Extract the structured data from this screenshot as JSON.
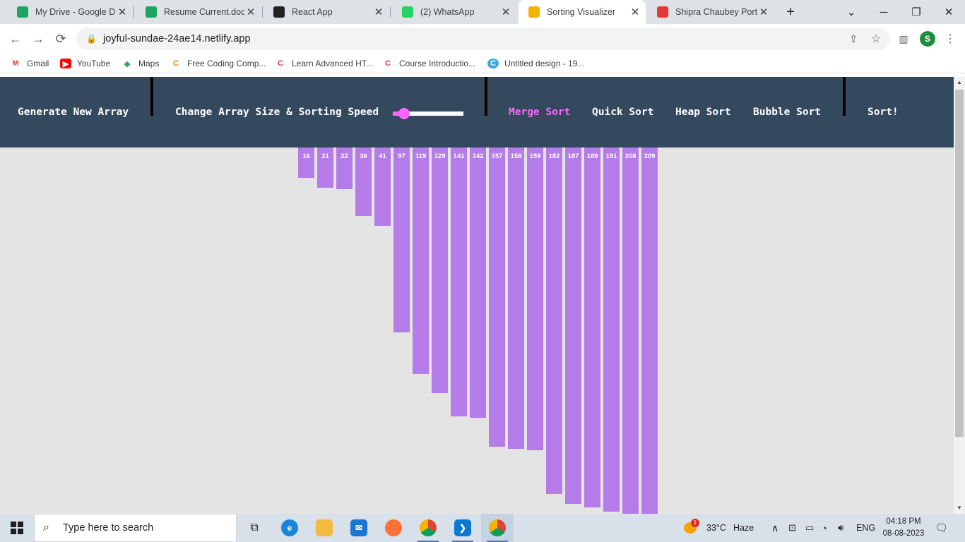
{
  "browser": {
    "tabs": [
      {
        "title": "My Drive - Google Dri",
        "icon": "google-drive-icon",
        "color": "#1fa463",
        "active": false
      },
      {
        "title": "Resume Current.docx.",
        "icon": "google-drive-icon",
        "color": "#1fa463",
        "active": false
      },
      {
        "title": "React App",
        "icon": "react-icon",
        "color": "#222222",
        "active": false
      },
      {
        "title": "(2) WhatsApp",
        "icon": "whatsapp-icon",
        "color": "#25d366",
        "active": false
      },
      {
        "title": "Sorting Visualizer",
        "icon": "bar-chart-icon",
        "color": "#f4b400",
        "active": true
      },
      {
        "title": "Shipra Chaubey Portfo",
        "icon": "portfolio-icon",
        "color": "#e53935",
        "active": false
      }
    ],
    "tab_close": "✕",
    "new_tab": "+",
    "url": "joyful-sundae-24ae14.netlify.app",
    "profile_initial": "S",
    "bookmarks": [
      {
        "label": "Gmail",
        "icon": "gmail-icon"
      },
      {
        "label": "YouTube",
        "icon": "youtube-icon"
      },
      {
        "label": "Maps",
        "icon": "maps-icon"
      },
      {
        "label": "Free Coding Comp...",
        "icon": "codecamp-icon"
      },
      {
        "label": "Learn Advanced HT...",
        "icon": "coursera-icon"
      },
      {
        "label": "Course Introductio...",
        "icon": "coursera-icon"
      },
      {
        "label": "Untitled design - 19...",
        "icon": "canva-icon"
      }
    ]
  },
  "app": {
    "generate_label": "Generate New Array",
    "size_speed_label": "Change Array Size & Sorting Speed",
    "slider_value": 0.16,
    "algorithms": [
      "Merge Sort",
      "Quick Sort",
      "Heap Sort",
      "Bubble Sort"
    ],
    "selected_algorithm": "Merge Sort",
    "sort_label": "Sort!",
    "colors": {
      "nav_bg": "#34495e",
      "bar": "#b57be8",
      "accent": "#ff66ff",
      "bg": "#e5e4e4"
    }
  },
  "array": {
    "values": [
      16,
      21,
      22,
      36,
      41,
      97,
      119,
      129,
      141,
      142,
      157,
      158,
      159,
      182,
      187,
      189,
      191,
      208,
      209
    ]
  },
  "taskbar": {
    "search_placeholder": "Type here to search",
    "weather_temp": "33°C",
    "weather_desc": "Haze",
    "weather_badge": "1",
    "language": "ENG",
    "time": "04:18 PM",
    "date": "08-08-2023"
  }
}
